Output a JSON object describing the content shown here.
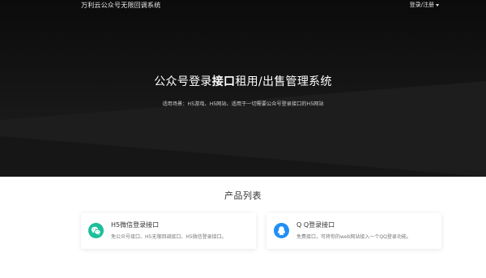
{
  "header": {
    "brand": "万利云公众号无限回调系统",
    "login_label": "登录/注册"
  },
  "hero": {
    "title_part1": "公众号登录",
    "title_bold1": "接口",
    "title_part2": "租用",
    "title_part3": "/出售管理系统",
    "subtitle": "适用场景：H5游戏、H5网站、适用于一切需要公众号登录接口的H5网站"
  },
  "products": {
    "section_title": "产品列表",
    "items": [
      {
        "title": "H5微信登录接口",
        "description": "免公众号接口、H5无限回调接口、H5微信登录接口。",
        "icon": "wechat-icon",
        "icon_color": "#1bbf9a"
      },
      {
        "title": "Q Q登录接口",
        "description": "免费接口，可将你的web网站接入一个QQ登录功能。",
        "icon": "qq-icon",
        "icon_color": "#1f8ff5"
      }
    ]
  },
  "colors": {
    "hero_bg": "#121212",
    "page_bg": "#ffffff",
    "text_dark": "#333333"
  }
}
